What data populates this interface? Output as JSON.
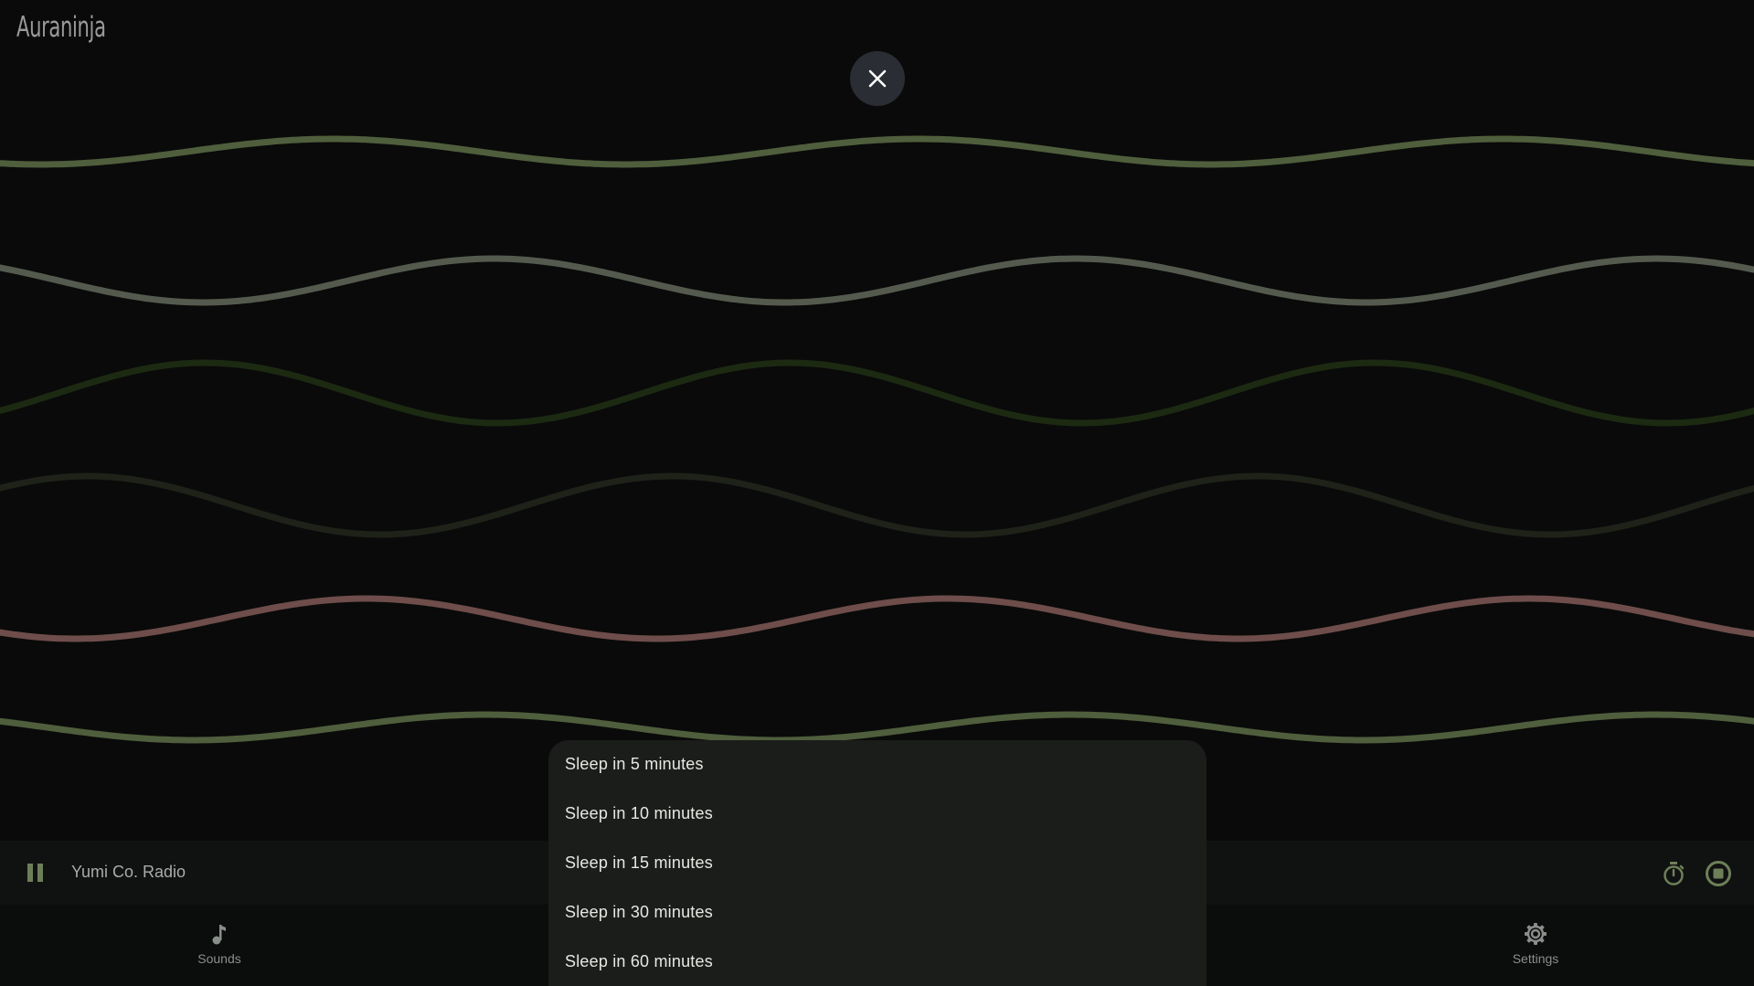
{
  "app": {
    "logo_text": "Auraninja"
  },
  "overlay": {
    "close_icon": "close-icon"
  },
  "waves_colors": [
    "#4f5e3c",
    "#555a4e",
    "#1c2a12",
    "#1e2219",
    "#6e4d4a",
    "#4f5e3c"
  ],
  "player": {
    "track_title": "Yumi Co. Radio",
    "pause_icon": "pause-icon",
    "timer_icon": "timer-icon",
    "stop_icon": "stop-circle-icon",
    "accent_color": "#6d7f58"
  },
  "nav": {
    "items": [
      {
        "label": "Sounds",
        "icon": "music-note-icon"
      },
      {
        "label": "Settings",
        "icon": "gear-icon"
      }
    ]
  },
  "sleep_menu": {
    "options": [
      "Sleep in 5 minutes",
      "Sleep in 10 minutes",
      "Sleep in 15 minutes",
      "Sleep in 30 minutes",
      "Sleep in 60 minutes"
    ]
  }
}
